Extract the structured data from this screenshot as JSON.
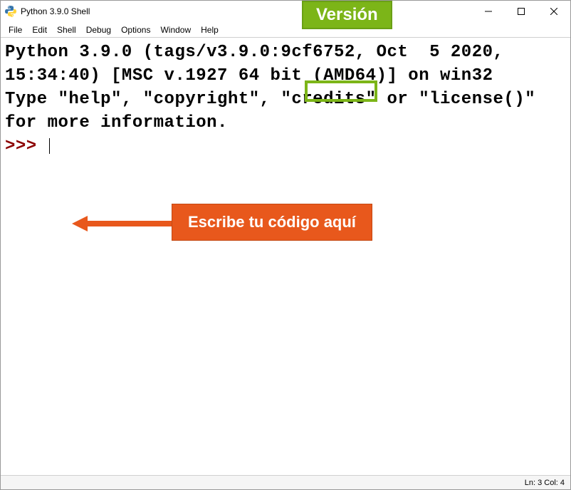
{
  "window": {
    "title": "Python 3.9.0 Shell"
  },
  "menu": {
    "items": [
      "File",
      "Edit",
      "Shell",
      "Debug",
      "Options",
      "Window",
      "Help"
    ]
  },
  "shell": {
    "line1": "Python 3.9.0 (tags/v3.9.0:9cf6752, Oct  5 2020, 15:34:40) [MSC v.1927 64 bit (AMD64)] on win32",
    "line2": "Type \"help\", \"copyright\", \"credits\" or \"license()\" for more information.",
    "prompt": ">>> "
  },
  "statusbar": {
    "text": "Ln: 3  Col: 4"
  },
  "annotations": {
    "version_label": "Versión",
    "code_hint": "Escribe tu código aquí"
  }
}
